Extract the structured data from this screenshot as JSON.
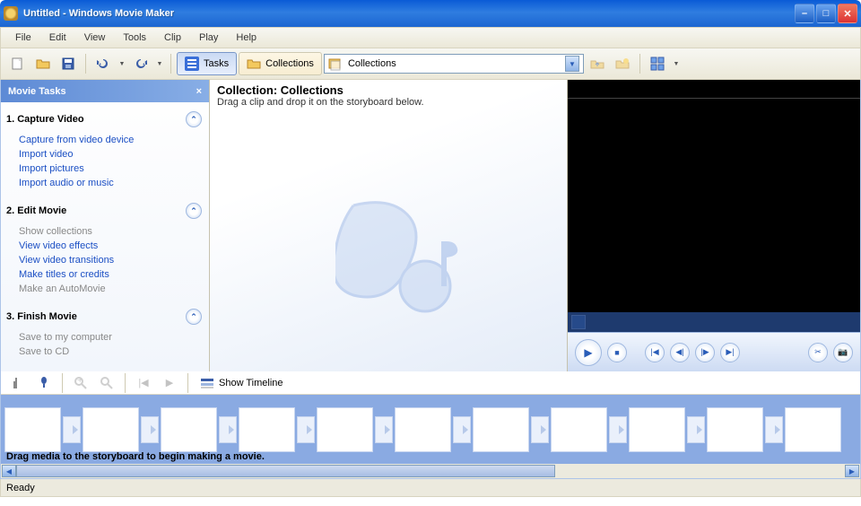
{
  "title": "Untitled - Windows Movie Maker",
  "menu": {
    "items": [
      "File",
      "Edit",
      "View",
      "Tools",
      "Clip",
      "Play",
      "Help"
    ]
  },
  "toolbar": {
    "tasks_label": "Tasks",
    "collections_label": "Collections",
    "select_value": "Collections"
  },
  "taskpane": {
    "title": "Movie Tasks",
    "groups": [
      {
        "title": "1. Capture Video",
        "links": [
          {
            "label": "Capture from video device",
            "enabled": true
          },
          {
            "label": "Import video",
            "enabled": true
          },
          {
            "label": "Import pictures",
            "enabled": true
          },
          {
            "label": "Import audio or music",
            "enabled": true
          }
        ]
      },
      {
        "title": "2. Edit Movie",
        "links": [
          {
            "label": "Show collections",
            "enabled": false
          },
          {
            "label": "View video effects",
            "enabled": true
          },
          {
            "label": "View video transitions",
            "enabled": true
          },
          {
            "label": "Make titles or credits",
            "enabled": true
          },
          {
            "label": "Make an AutoMovie",
            "enabled": false
          }
        ]
      },
      {
        "title": "3. Finish Movie",
        "links": [
          {
            "label": "Save to my computer",
            "enabled": false
          },
          {
            "label": "Save to CD",
            "enabled": false
          }
        ]
      }
    ]
  },
  "collection": {
    "heading": "Collection: Collections",
    "hint": "Drag a clip and drop it on the storyboard below."
  },
  "storyboard": {
    "show_timeline_label": "Show Timeline",
    "hint": "Drag media to the storyboard to begin making a movie."
  },
  "status": {
    "text": "Ready"
  }
}
